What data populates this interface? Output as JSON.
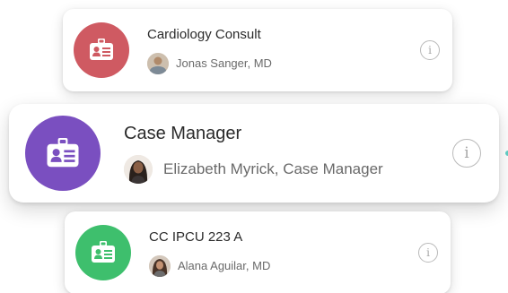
{
  "colors": {
    "cardiology": "#cf5a62",
    "case_manager": "#7a4fc0",
    "ipcu": "#3ebf6d",
    "edge_dot": "#5fc9c0"
  },
  "cards": [
    {
      "title": "Cardiology Consult",
      "person": "Jonas Sanger, MD",
      "icon": "id-card-icon",
      "info_icon": "info-icon",
      "info_glyph": "i"
    },
    {
      "title": "Case Manager",
      "person": "Elizabeth Myrick, Case Manager",
      "icon": "id-card-icon",
      "info_icon": "info-icon",
      "info_glyph": "i"
    },
    {
      "title": "CC IPCU 223 A",
      "person": "Alana Aguilar, MD",
      "icon": "id-card-icon",
      "info_icon": "info-icon",
      "info_glyph": "i"
    }
  ]
}
